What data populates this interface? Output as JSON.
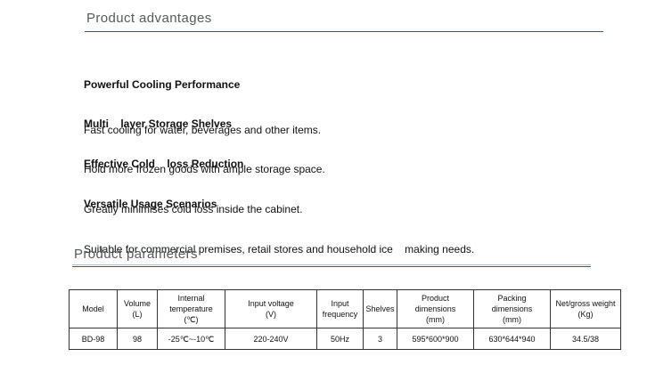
{
  "advantages": {
    "title": "Product advantages",
    "items": [
      {
        "title": "Powerful Cooling Performance",
        "desc": "Fast cooling for water, beverages and other items."
      },
      {
        "title": "Multi    layer Storage Shelves",
        "desc": "Hold more frozen goods with ample storage space."
      },
      {
        "title": "Effective Cold    loss Reduction",
        "desc": "Greatly minimises cold loss inside the cabinet."
      },
      {
        "title": "Versatile Usage Scenarios",
        "desc": "Suitable for commercial premises, retail stores and household ice    making needs."
      }
    ]
  },
  "parameters": {
    "title": "Product parameters",
    "headers": [
      "Model",
      "Volume\n(L)",
      "Internal\ntemperature\n(℃)",
      "Input voltage\n(V)",
      "Input\nfrequency",
      "Shelves",
      "Product\ndimensions\n(mm)",
      "Packing\ndimensions\n(mm)",
      "Net/gross weight\n(Kg)"
    ],
    "rows": [
      [
        "BD-98",
        "98",
        "-25℃~-10℃",
        "220-240V",
        "50Hz",
        "3",
        "595*600*900",
        "630*644*940",
        "34.5/38"
      ]
    ]
  }
}
